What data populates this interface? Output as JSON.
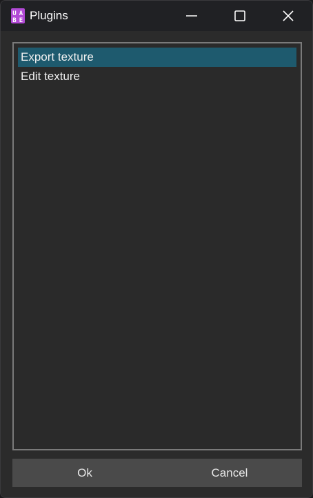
{
  "window": {
    "title": "Plugins",
    "app_icon": "uabe-icon",
    "controls": {
      "minimize_icon": "minimize-icon",
      "maximize_icon": "maximize-icon",
      "close_icon": "close-icon"
    }
  },
  "plugins_list": {
    "items": [
      {
        "label": "Export texture",
        "selected": true
      },
      {
        "label": "Edit texture",
        "selected": false
      }
    ]
  },
  "footer": {
    "ok_label": "Ok",
    "cancel_label": "Cancel"
  },
  "colors": {
    "selection": "#1e5a6e",
    "background": "#2b2b2b",
    "titlebar": "#202124",
    "footer": "#4a4a4a",
    "icon_accent": "#b24ad6"
  }
}
